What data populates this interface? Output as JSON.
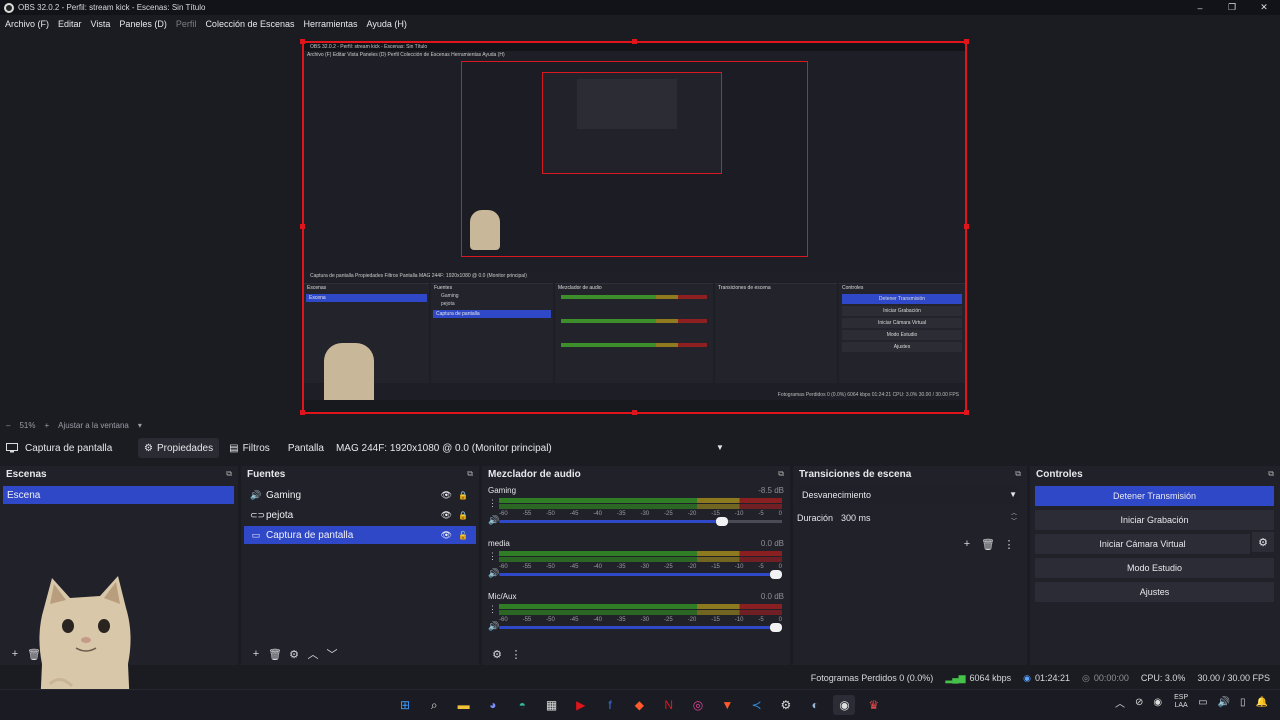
{
  "window": {
    "title": "OBS 32.0.2 - Perfil: stream kick - Escenas: Sin Título",
    "controls": [
      "–",
      "❐",
      "✕"
    ]
  },
  "menu": {
    "items": [
      "Archivo (F)",
      "Editar",
      "Vista",
      "Paneles (D)",
      "Perfil",
      "Colección de Escenas",
      "Herramientas",
      "Ayuda (H)"
    ]
  },
  "preview": {
    "nested_title": "OBS 32.0.2 - Perfil: stream kick - Escenas: Sin Título",
    "nested_menu": "Archivo (F)   Editar   Vista   Paneles (D)   Perfil   Colección de Escenas   Herramientas   Ayuda (H)",
    "nested_context": "Captura de pantalla     Propiedades     Filtros     Pantalla   MAG 244F: 1920x1080 @ 0.0 (Monitor principal)",
    "nested_status": "Fotogramas Perdidos 0 (0.0%)    6064 kbps    01:24:21    CPU: 3.0%    30.00 / 30.00 FPS",
    "nested_scenes": "Escenas",
    "nested_sources": "Fuentes",
    "nested_mixer": "Mezclador de audio",
    "nested_transitions": "Transiciones de escena",
    "nested_controls": "Controles"
  },
  "zoom": {
    "minus": "–",
    "level": "51%",
    "plus": "+",
    "fit": "Ajustar a la ventana",
    "arrow": "▾"
  },
  "context": {
    "source_name": "Captura de pantalla",
    "properties": "Propiedades",
    "filters": "Filtros",
    "display_label": "Pantalla",
    "display_value": "MAG 244F: 1920x1080 @ 0.0 (Monitor principal)"
  },
  "scenes": {
    "title": "Escenas",
    "items": [
      {
        "label": "Escena",
        "selected": true
      }
    ]
  },
  "sources": {
    "title": "Fuentes",
    "items": [
      {
        "label": "Gaming",
        "icon": "speaker-icon",
        "selected": false
      },
      {
        "label": "pejota",
        "icon": "link-icon",
        "selected": false
      },
      {
        "label": "Captura de pantalla",
        "icon": "monitor-icon",
        "selected": true
      }
    ]
  },
  "mixer": {
    "title": "Mezclador de audio",
    "scale": [
      "-60",
      "-55",
      "-50",
      "-45",
      "-40",
      "-35",
      "-30",
      "-25",
      "-20",
      "-15",
      "-10",
      "-5",
      "0"
    ],
    "tracks": [
      {
        "name": "Gaming",
        "db": "-8.5 dB",
        "volume": 0.8
      },
      {
        "name": "media",
        "db": "0.0 dB",
        "volume": 1.0
      },
      {
        "name": "Mic/Aux",
        "db": "0.0 dB",
        "volume": 1.0
      }
    ]
  },
  "transitions": {
    "title": "Transiciones de escena",
    "selected": "Desvanecimiento",
    "duration_label": "Duración",
    "duration_value": "300 ms"
  },
  "controls": {
    "title": "Controles",
    "buttons": [
      "Detener Transmisión",
      "Iniciar Grabación",
      "Iniciar Cámara Virtual",
      "Modo Estudio",
      "Ajustes"
    ]
  },
  "status": {
    "dropped": "Fotogramas Perdidos 0 (0.0%)",
    "bitrate": "6064 kbps",
    "stream_time": "01:24:21",
    "rec_time": "00:00:00",
    "cpu": "CPU: 3.0%",
    "fps": "30.00 / 30.00 FPS"
  },
  "taskbar": {
    "icons": [
      "windows-start-icon",
      "search-icon",
      "file-explorer-icon",
      "discord-icon",
      "edge-icon",
      "store-icon",
      "youtube-icon",
      "facebook-icon",
      "brave-icon",
      "netflix-icon",
      "instagram-icon",
      "brave-browser-icon",
      "vscode-icon",
      "obs-settings-icon",
      "steam-icon",
      "obs-icon",
      "extra-icon"
    ],
    "lang_top": "ESP",
    "lang_bottom": "LAA"
  },
  "colors": {
    "accent": "#2f48c8",
    "preview_border": "#e0141b",
    "background": "#1b1c22",
    "panel": "#202129"
  }
}
